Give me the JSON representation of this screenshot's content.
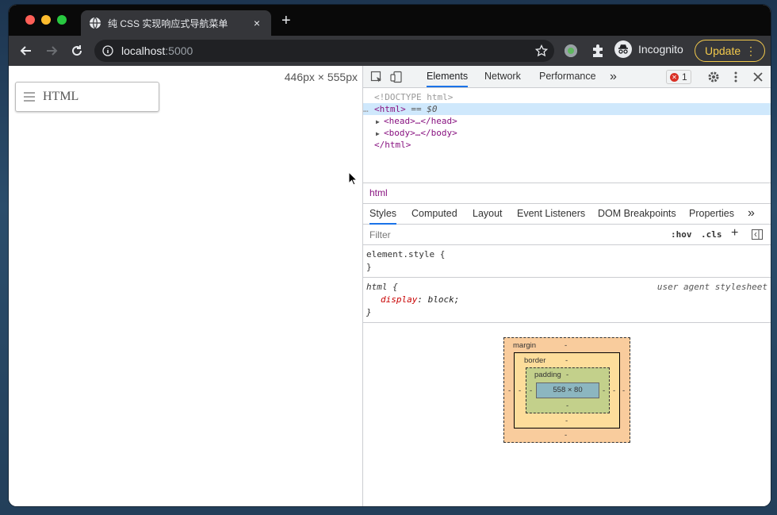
{
  "tab": {
    "title": "纯 CSS 实现响应式导航菜单",
    "close": "×",
    "new_tab": "+"
  },
  "address": {
    "host": "localhost",
    "port": ":5000"
  },
  "profile": {
    "label": "Incognito"
  },
  "update": {
    "label": "Update",
    "dots": "⋮"
  },
  "page": {
    "dimensions": "446px × 555px",
    "nav_label": "HTML"
  },
  "devtools": {
    "tabs": [
      "Elements",
      "Network",
      "Performance"
    ],
    "more": "»",
    "error_count": "1",
    "dom": {
      "doctype": "<!DOCTYPE html>",
      "html_open": "<html>",
      "eq_label": "== $0",
      "head": "<head>…</head>",
      "body": "<body>…</body>",
      "html_close": "</html>",
      "ellipsis": "…"
    },
    "breadcrumb": "html",
    "sub_tabs": [
      "Styles",
      "Computed",
      "Layout",
      "Event Listeners",
      "DOM Breakpoints",
      "Properties"
    ],
    "sub_more": "»",
    "filter": {
      "placeholder": "Filter",
      "hov": ":hov",
      "cls": ".cls",
      "plus": "+"
    },
    "rules": {
      "element_style_open": "element.style {",
      "element_style_close": "}",
      "html_selector": "html {",
      "ua_label": "user agent stylesheet",
      "prop_name": "display",
      "prop_value": "block;",
      "html_close": "}"
    },
    "box_model": {
      "margin_label": "margin",
      "border_label": "border",
      "padding_label": "padding",
      "dash": "-",
      "content": "558 × 80"
    }
  }
}
